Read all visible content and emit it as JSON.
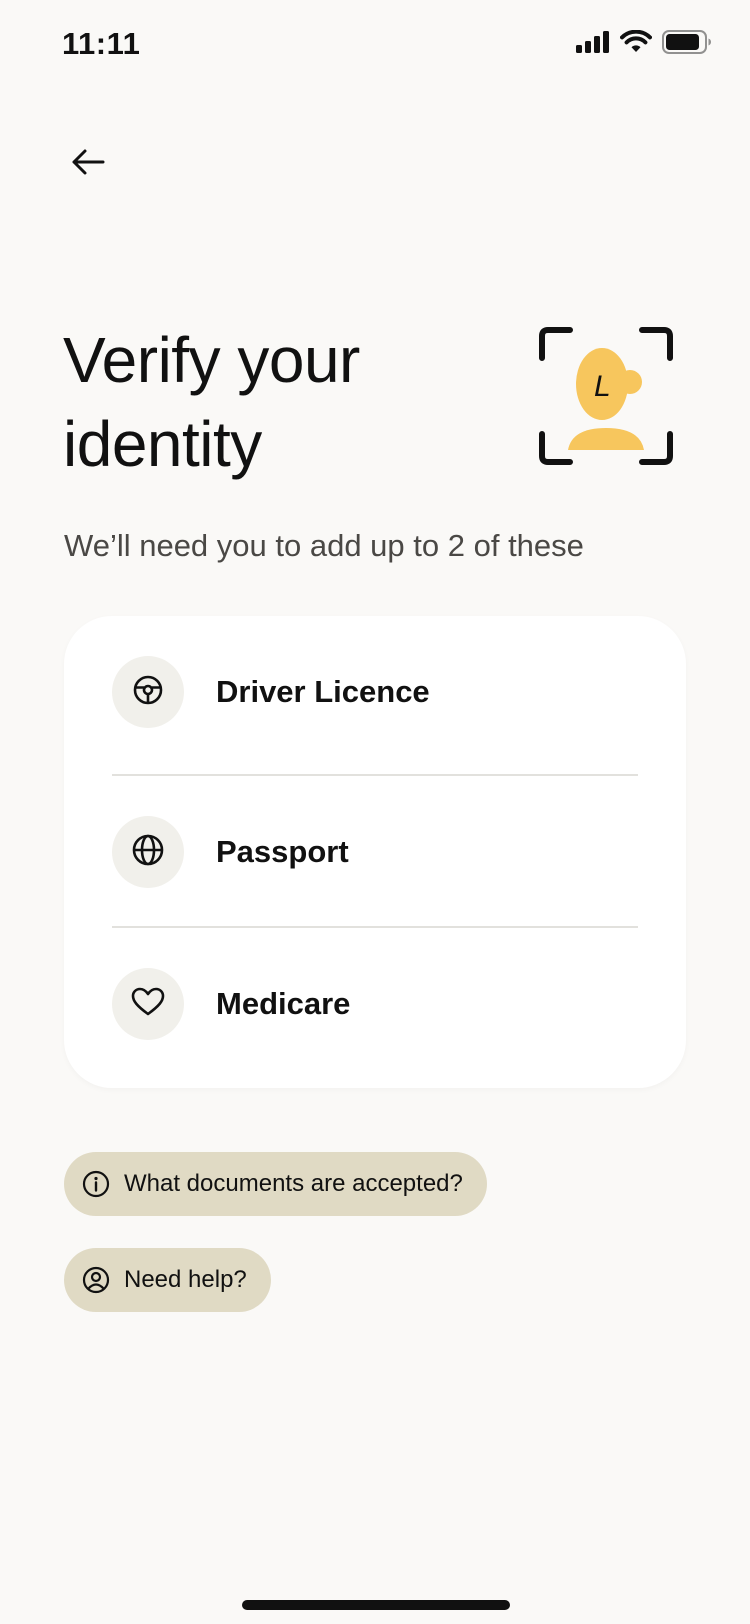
{
  "status_bar": {
    "time": "11:11"
  },
  "header": {
    "back_label": "Back"
  },
  "hero": {
    "title_line1": "Verify your",
    "title_line2": "identity",
    "illustration_letter": "L",
    "subtitle": "We’ll need you to add up to 2 of these"
  },
  "documents": {
    "items": [
      {
        "label": "Driver Licence",
        "icon": "steering-wheel-icon"
      },
      {
        "label": "Passport",
        "icon": "globe-icon"
      },
      {
        "label": "Medicare",
        "icon": "heart-icon"
      }
    ]
  },
  "help": {
    "accepted_docs_label": "What documents are accepted?",
    "need_help_label": "Need help?"
  },
  "colors": {
    "background": "#FAF9F7",
    "card": "#FFFFFF",
    "icon_bg": "#F1F0EB",
    "pill_bg": "#E0DAC4",
    "accent_yellow": "#F7C65D"
  }
}
